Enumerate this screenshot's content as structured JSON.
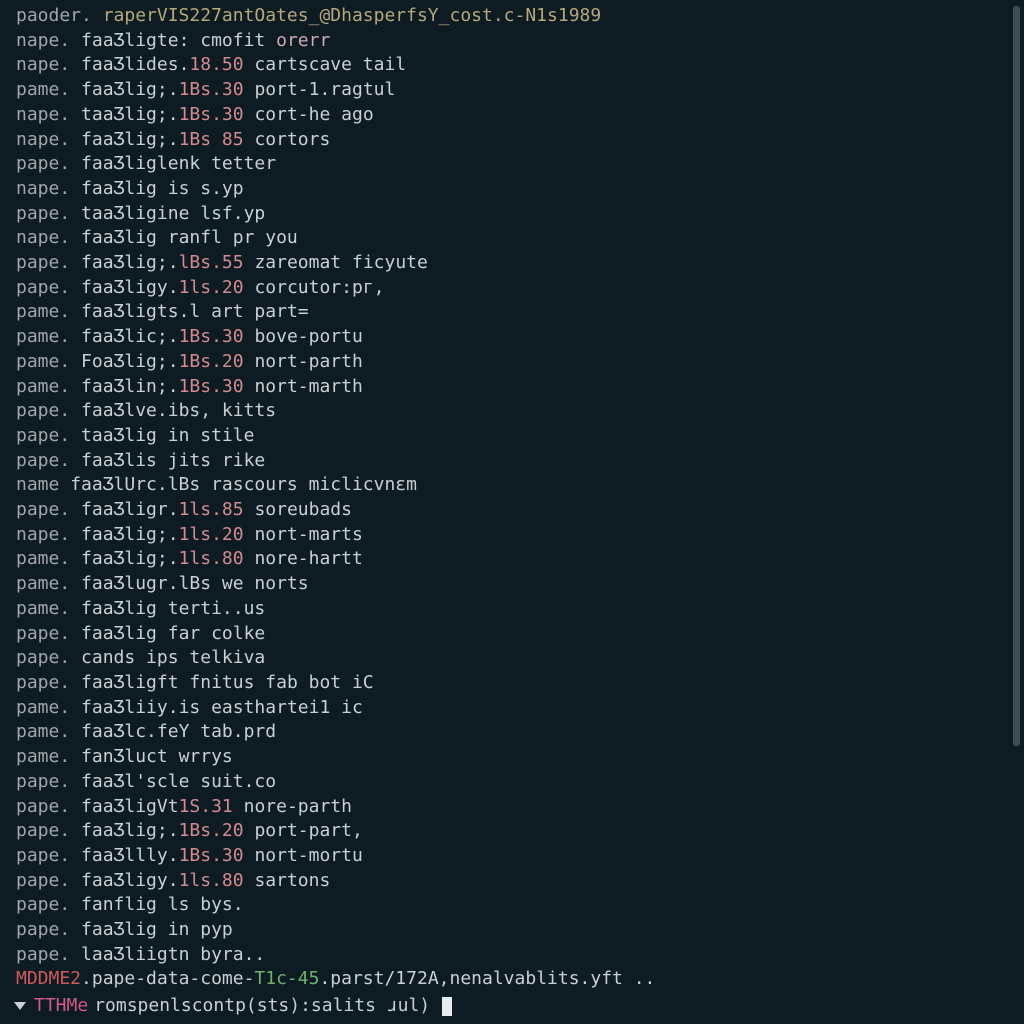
{
  "header_line": {
    "seg1": "paoder.",
    "seg2": "raperVIS227antOates_@DhasperfsY_cost.c-N1s1989"
  },
  "lines": [
    {
      "a": "nape.",
      "b": "faaƷligte:",
      "c": "",
      "d": "cmofit",
      "e": "orerr"
    },
    {
      "a": "nape.",
      "b": "faaƷlides.",
      "c": "18.50",
      "d": "cartscave tail",
      "e": ""
    },
    {
      "a": "pame.",
      "b": "faaƷlig;.",
      "c": "1Bs.30",
      "d": "port-1.ragtul",
      "e": ""
    },
    {
      "a": "nape.",
      "b": "taaƷlig;.",
      "c": "1Bs.30",
      "d": "cort-he ago",
      "e": ""
    },
    {
      "a": "nape.",
      "b": "faaƷlig;.",
      "c": "1Bs 85",
      "d": "cortors",
      "e": ""
    },
    {
      "a": "pape.",
      "b": "faaƷliglenk",
      "c": "",
      "d": "tetter",
      "e": ""
    },
    {
      "a": "nape.",
      "b": "faaƷlig",
      "c": "",
      "d": "is s.yp",
      "e": ""
    },
    {
      "a": "pape.",
      "b": "taaƷligine",
      "c": "",
      "d": "lsf.yp",
      "e": ""
    },
    {
      "a": "nape.",
      "b": "faaƷlig",
      "c": "",
      "d": "ranfl pr you",
      "e": ""
    },
    {
      "a": "pape.",
      "b": "faaƷlig;.",
      "c": "lBs.55",
      "d": "zareomat ficyute",
      "e": ""
    },
    {
      "a": "pape.",
      "b": "faaƷligy.",
      "c": "1ls.20",
      "d": "corcutor:pг,",
      "e": ""
    },
    {
      "a": "pame.",
      "b": "faaƷligts.l",
      "c": "",
      "d": "art part=",
      "e": ""
    },
    {
      "a": "pame.",
      "b": "faaƷlic;.",
      "c": "1Bs.30",
      "d": "bove-portu",
      "e": ""
    },
    {
      "a": "pame.",
      "b": "FoaƷlig;.",
      "c": "1Bs.20",
      "d": "nort-parth",
      "e": ""
    },
    {
      "a": "pame.",
      "b": "faaƷlin;.",
      "c": "1Bs.30",
      "d": "nort-marth",
      "e": ""
    },
    {
      "a": "pape.",
      "b": "faaƷlve.ibs,",
      "c": "",
      "d": "kitts",
      "e": ""
    },
    {
      "a": "pape.",
      "b": "taaƷlig",
      "c": "",
      "d": "in stile",
      "e": ""
    },
    {
      "a": "pape.",
      "b": "faaƷlis",
      "c": "",
      "d": "jits rike",
      "e": ""
    },
    {
      "a": "name",
      "b": "faaƷlUrc.lBs",
      "c": "",
      "d": "rascours miclicvnɛm",
      "e": ""
    },
    {
      "a": "pape.",
      "b": "faaƷligr.",
      "c": "1ls.85",
      "d": "soreubads",
      "e": ""
    },
    {
      "a": "nape.",
      "b": "faaƷlig;.",
      "c": "1ls.20",
      "d": "nort-marts",
      "e": ""
    },
    {
      "a": "pame.",
      "b": "faaƷlig;.",
      "c": "1ls.80",
      "d": "nore-hartt",
      "e": ""
    },
    {
      "a": "pame.",
      "b": "faaƷlugr.lBs",
      "c": "",
      "d": "we norts",
      "e": ""
    },
    {
      "a": "pame.",
      "b": "faaƷlig",
      "c": "",
      "d": "terti..us",
      "e": ""
    },
    {
      "a": "pape.",
      "b": "faaƷlig",
      "c": "",
      "d": "far colke",
      "e": ""
    },
    {
      "a": "pape.",
      "b": "cands",
      "c": "",
      "d": "ips telkiva",
      "e": ""
    },
    {
      "a": "pape.",
      "b": "faaƷligft",
      "c": "",
      "d": "fnitus fab bot iC",
      "e": ""
    },
    {
      "a": "pame.",
      "b": "faaƷliiy.is",
      "c": "",
      "d": "easthartei1 ic",
      "e": ""
    },
    {
      "a": "pame.",
      "b": "faaƷlc.feY",
      "c": "",
      "d": "tab.prd",
      "e": ""
    },
    {
      "a": "pame.",
      "b": "fanƷluct",
      "c": "",
      "d": "wrrys",
      "e": ""
    },
    {
      "a": "pape.",
      "b": "faaƷl'scle",
      "c": "",
      "d": "suit.co",
      "e": ""
    },
    {
      "a": "pape.",
      "b": "faaƷligVt",
      "c": "1S.31",
      "d": "nore-parth",
      "e": ""
    },
    {
      "a": "pape.",
      "b": "faaƷlig;.",
      "c": "1Bs.20",
      "d": "port-part,",
      "e": ""
    },
    {
      "a": "pape.",
      "b": "faaƷllly.",
      "c": "1Bs.30",
      "d": "nort-mortu",
      "e": ""
    },
    {
      "a": "pape.",
      "b": "faaƷligy.",
      "c": "1ls.80",
      "d": "sartons",
      "e": ""
    },
    {
      "a": "pape.",
      "b": "fanflig",
      "c": "",
      "d": "ls bys.",
      "e": ""
    },
    {
      "a": "pape.",
      "b": "faaƷlig",
      "c": "",
      "d": "in pyp",
      "e": ""
    },
    {
      "a": "pape.",
      "b": "laaƷliigtn",
      "c": "",
      "d": "byra..",
      "e": ""
    }
  ],
  "status_line": {
    "tag": "MDDME2",
    "body": ".pape-data-come-",
    "grn": "T1c-45",
    "rest": ".parst/172A,nenalvablits.yft .."
  },
  "prompt": {
    "label": "TTHMe",
    "cmd": "romspenlscontp(sts):salits ɹul)"
  }
}
